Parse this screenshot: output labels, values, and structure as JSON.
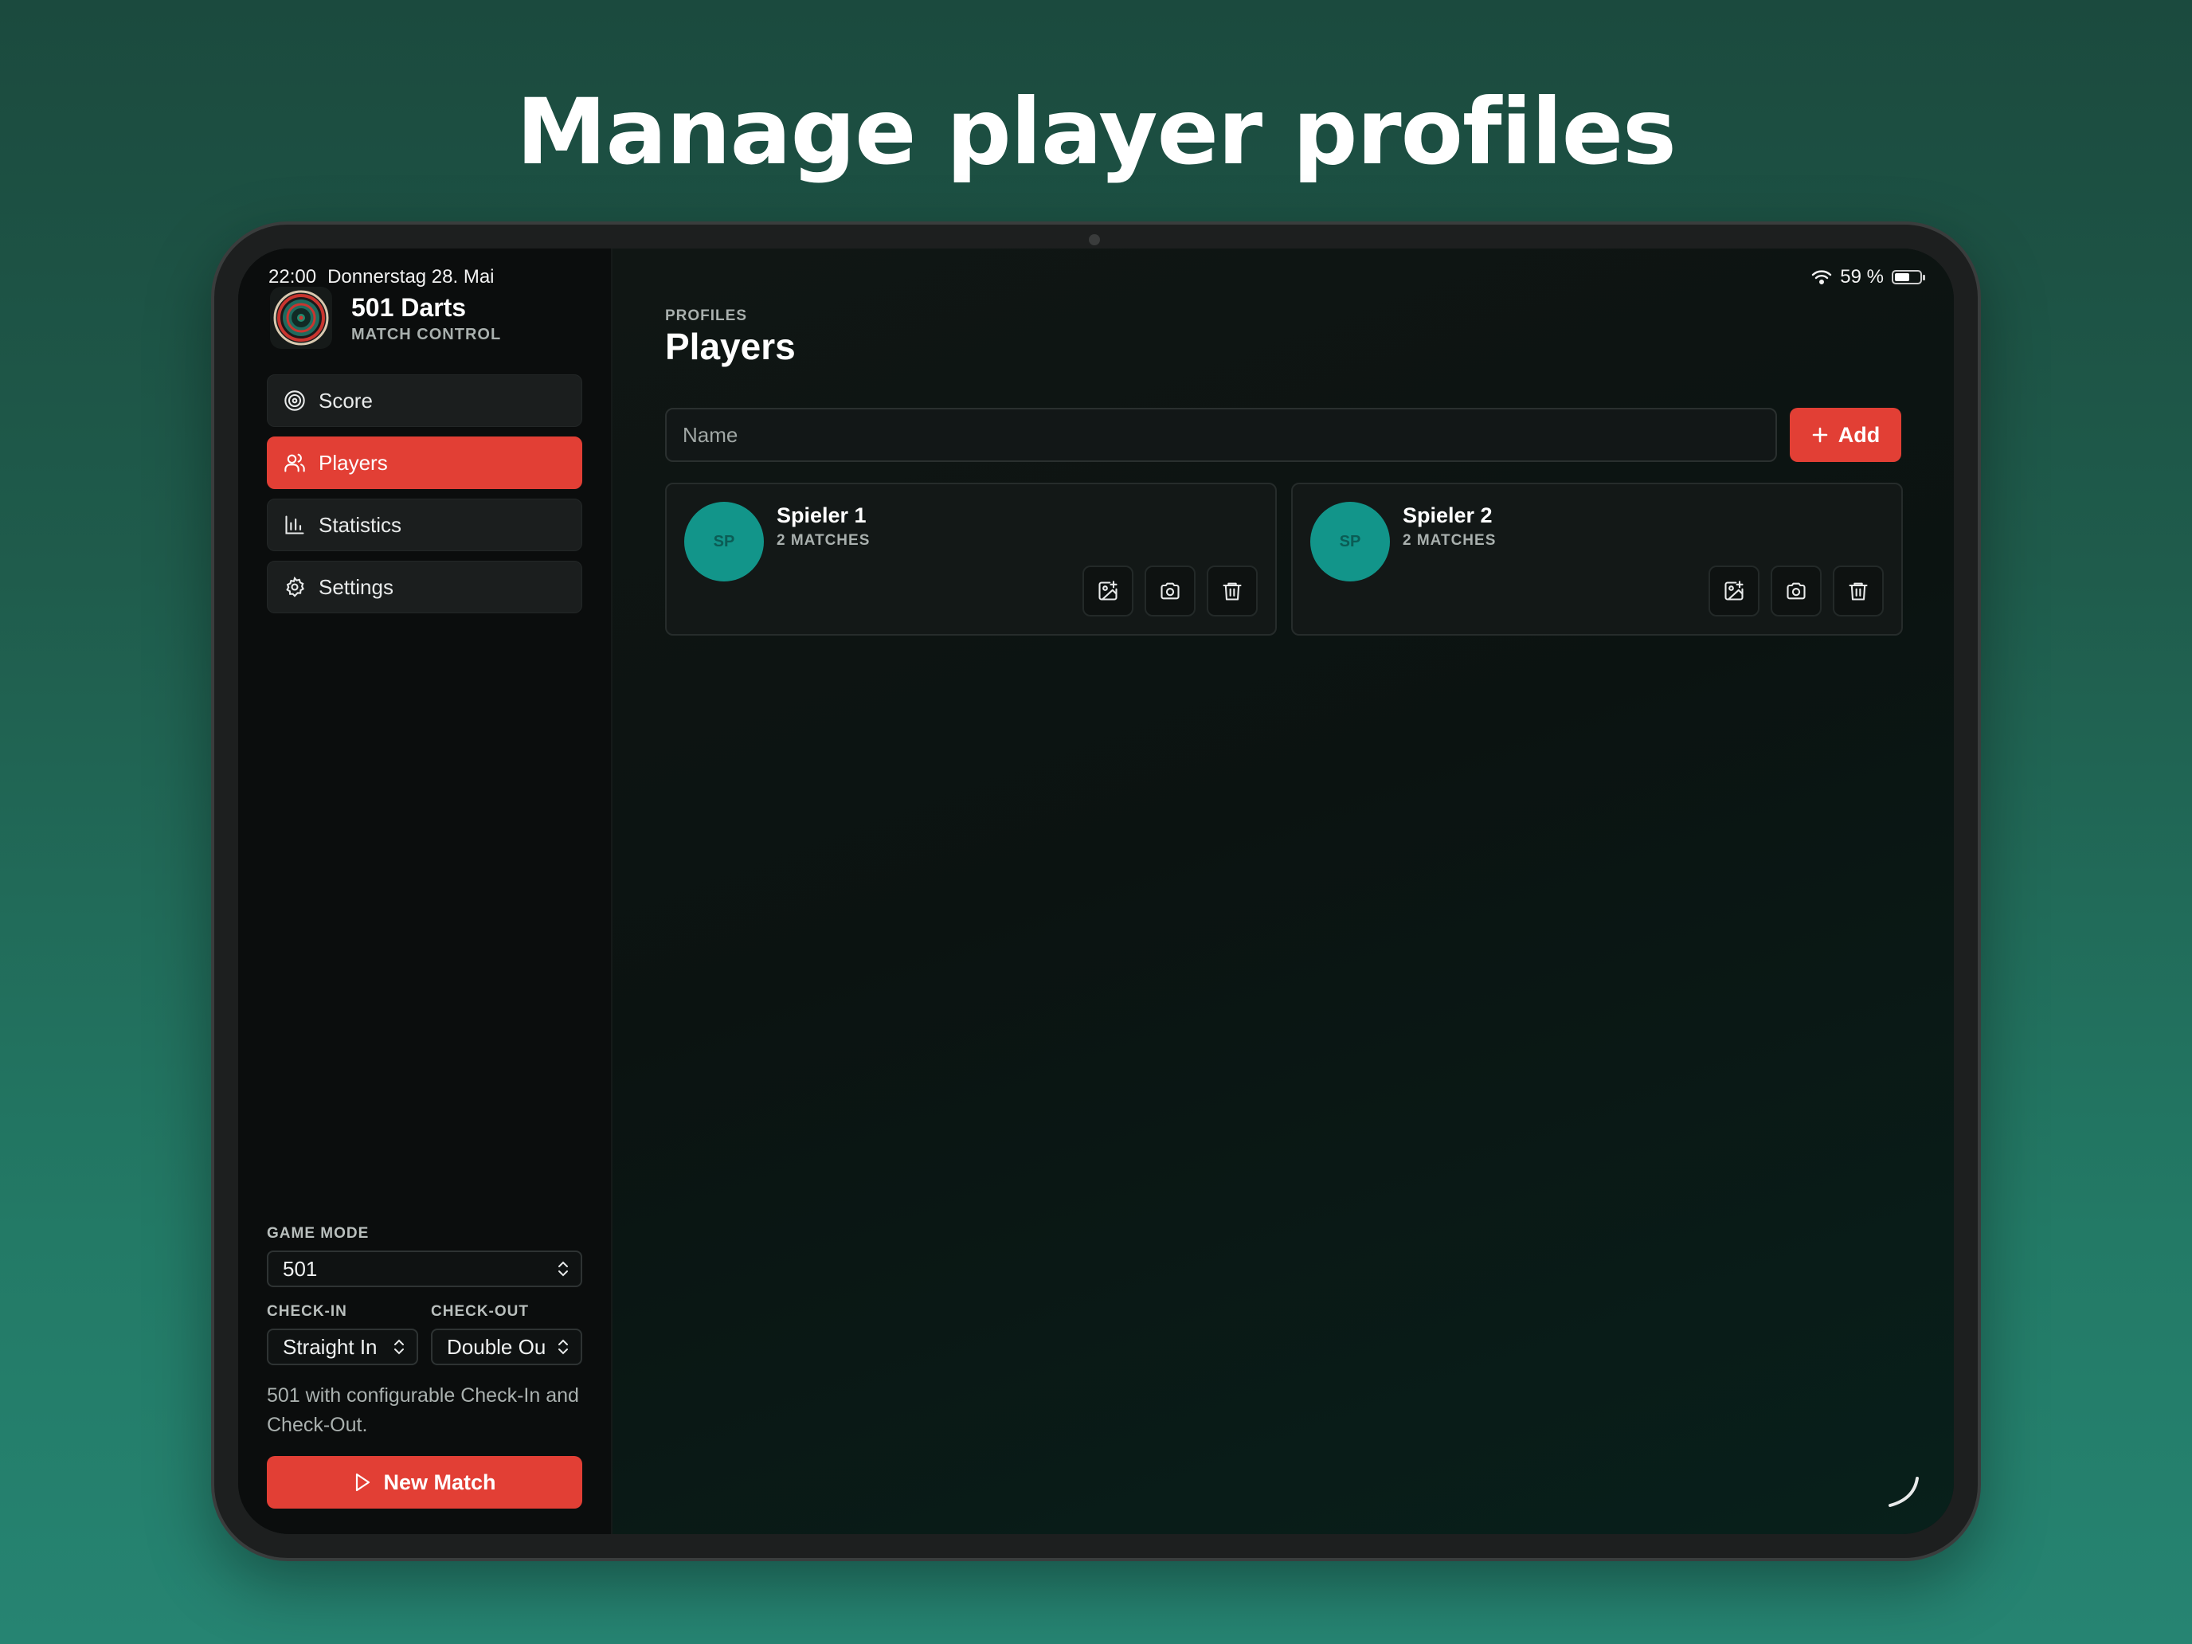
{
  "headline": "Manage player profiles",
  "status_bar": {
    "time": "22:00",
    "date": "Donnerstag 28. Mai",
    "battery": "59 %",
    "battery_level": 0.59
  },
  "app": {
    "title": "501 Darts",
    "subtitle": "MATCH CONTROL"
  },
  "nav": {
    "items": [
      {
        "label": "Score",
        "icon": "target-icon",
        "active": false
      },
      {
        "label": "Players",
        "icon": "users-icon",
        "active": true
      },
      {
        "label": "Statistics",
        "icon": "bar-chart-icon",
        "active": false
      },
      {
        "label": "Settings",
        "icon": "gear-icon",
        "active": false
      }
    ]
  },
  "game": {
    "mode_label": "GAME MODE",
    "mode_value": "501",
    "checkin_label": "CHECK-IN",
    "checkin_value": "Straight In",
    "checkout_label": "CHECK-OUT",
    "checkout_value": "Double Ou",
    "description": "501 with configurable Check-In and Check-Out.",
    "new_match_label": "New Match"
  },
  "page": {
    "overline": "PROFILES",
    "title": "Players",
    "name_placeholder": "Name",
    "add_label": "Add"
  },
  "players": [
    {
      "initials": "SP",
      "name": "Spieler 1",
      "matches": "2 MATCHES"
    },
    {
      "initials": "SP",
      "name": "Spieler 2",
      "matches": "2 MATCHES"
    }
  ],
  "colors": {
    "accent": "#e23f35",
    "avatar": "#12958a",
    "sidebar_bg": "#0b0d0d",
    "background_top": "#1b4a3e",
    "background_bottom": "#268472"
  }
}
